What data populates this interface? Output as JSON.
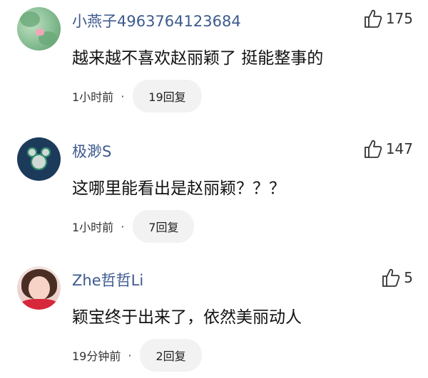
{
  "comments": [
    {
      "username": "小燕子4963764123684",
      "likes": "175",
      "text": "越来越不喜欢赵丽颖了 挺能整事的",
      "time": "1小时前",
      "replies": "19回复",
      "avatar": "lotus-avatar"
    },
    {
      "username": "极渺S",
      "likes": "147",
      "text": "这哪里能看出是赵丽颖？？？",
      "time": "1小时前",
      "replies": "7回复",
      "avatar": "mickey-avatar"
    },
    {
      "username": "Zhe哲哲Li",
      "likes": "5",
      "text": "颖宝终于出来了，依然美丽动人",
      "time": "19分钟前",
      "replies": "2回复",
      "avatar": "girl-avatar"
    }
  ],
  "separator": "·",
  "colors": {
    "username": "#3d5a8e",
    "reply_bg": "#f2f2f2",
    "text": "#111111"
  },
  "icons": {
    "like": "thumbs-up-icon"
  }
}
